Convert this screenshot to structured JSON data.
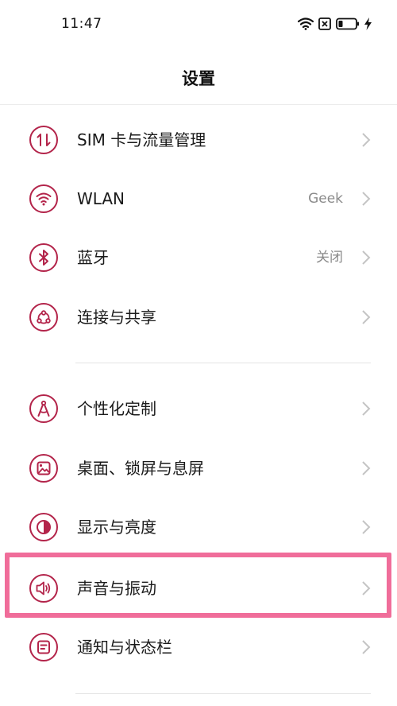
{
  "status_bar": {
    "time": "11:47",
    "icons": [
      "wifi-icon",
      "sim-off-icon",
      "battery-icon",
      "charging-icon"
    ]
  },
  "header": {
    "title": "设置"
  },
  "accent_color": "#b3244a",
  "highlight_color": "#f06d9a",
  "menu": {
    "group1": [
      {
        "label": "SIM 卡与流量管理",
        "value": "",
        "icon": "sim-data-icon"
      },
      {
        "label": "WLAN",
        "value": "Geek",
        "icon": "wifi-icon"
      },
      {
        "label": "蓝牙",
        "value": "关闭",
        "icon": "bluetooth-icon"
      },
      {
        "label": "连接与共享",
        "value": "",
        "icon": "share-connection-icon"
      }
    ],
    "group2": [
      {
        "label": "个性化定制",
        "value": "",
        "icon": "personalize-icon"
      },
      {
        "label": "桌面、锁屏与息屏",
        "value": "",
        "icon": "wallpaper-icon"
      },
      {
        "label": "显示与亮度",
        "value": "",
        "icon": "brightness-icon"
      },
      {
        "label": "声音与振动",
        "value": "",
        "icon": "speaker-icon"
      },
      {
        "label": "通知与状态栏",
        "value": "",
        "icon": "notification-icon"
      }
    ]
  }
}
